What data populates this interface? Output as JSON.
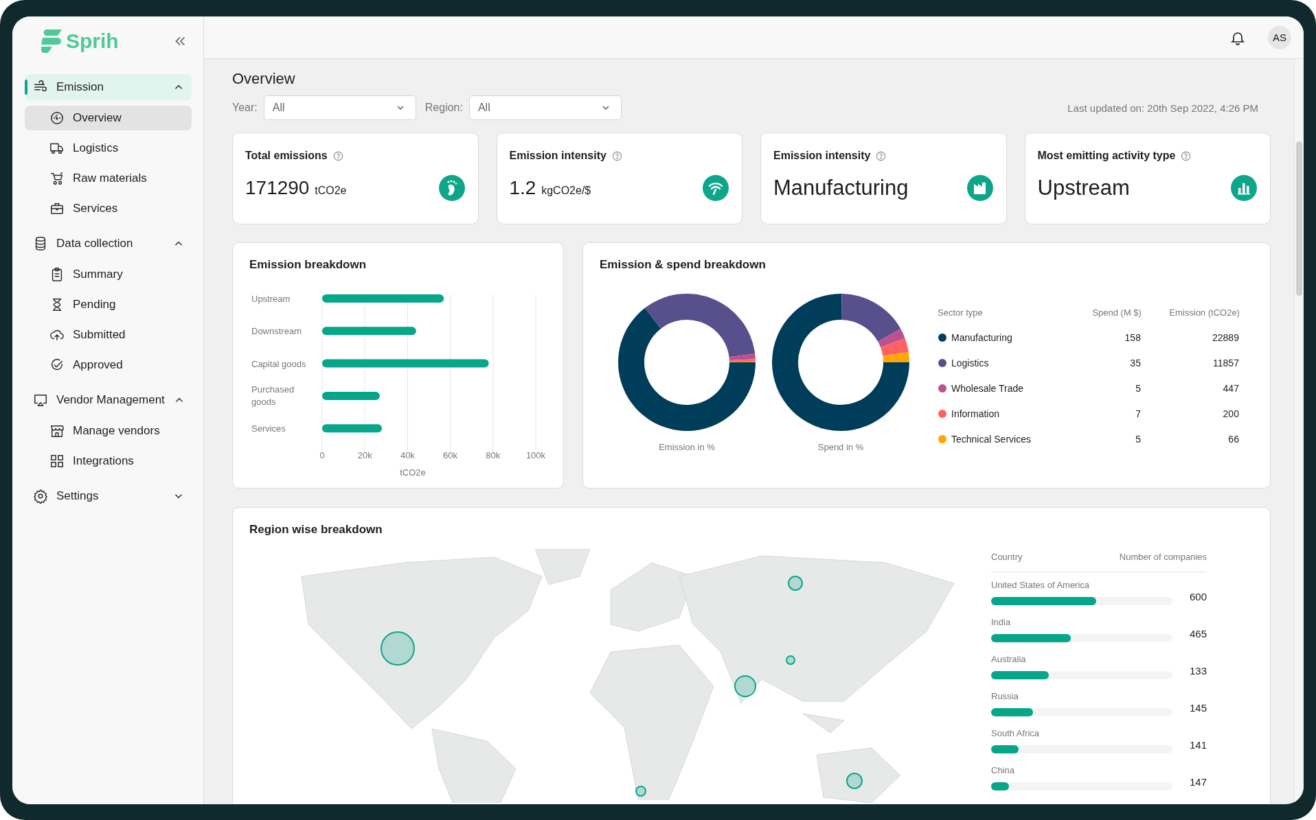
{
  "sidebar": {
    "brand": "Sprih",
    "groups": [
      {
        "label": "Emission",
        "expanded": true,
        "active": true,
        "items": [
          {
            "label": "Overview",
            "selected": true
          },
          {
            "label": "Logistics",
            "selected": false
          },
          {
            "label": "Raw materials",
            "selected": false
          },
          {
            "label": "Services",
            "selected": false
          }
        ]
      },
      {
        "label": "Data collection",
        "expanded": true,
        "active": false,
        "items": [
          {
            "label": "Summary",
            "selected": false
          },
          {
            "label": "Pending",
            "selected": false
          },
          {
            "label": "Submitted",
            "selected": false
          },
          {
            "label": "Approved",
            "selected": false
          }
        ]
      },
      {
        "label": "Vendor Management",
        "expanded": true,
        "active": false,
        "items": [
          {
            "label": "Manage vendors",
            "selected": false
          },
          {
            "label": "Integrations",
            "selected": false
          }
        ]
      },
      {
        "label": "Settings",
        "expanded": false,
        "active": false
      }
    ]
  },
  "header": {
    "avatar": "AS"
  },
  "page": {
    "title": "Overview",
    "filters": [
      {
        "label": "Year:",
        "value": "All"
      },
      {
        "label": "Region:",
        "value": "All"
      }
    ],
    "last_updated": "Last updated on: 20th Sep 2022, 4:26 PM"
  },
  "cards": [
    {
      "title": "Total emissions",
      "kind": "quantity",
      "value": "171290",
      "unit": "tCO2e"
    },
    {
      "title": "Emission intensity",
      "kind": "quantity",
      "value": "1.2",
      "unit": "kgCO2e/$"
    },
    {
      "title": "Emission intensity",
      "kind": "category",
      "value": "Manufacturing"
    },
    {
      "title": "Most emitting activity type",
      "kind": "category",
      "value": "Upstream"
    }
  ],
  "emission_breakdown": {
    "title": "Emission breakdown",
    "chart_data": {
      "type": "bar",
      "orientation": "horizontal",
      "categories": [
        "Upstream",
        "Downstream",
        "Capital goods",
        "Purchased goods",
        "Services"
      ],
      "values": [
        57000,
        44000,
        78000,
        27000,
        28000
      ],
      "grid": true,
      "xlabel": "tCO2e",
      "xlim": [
        0,
        100000
      ],
      "xticks": [
        {
          "value": 0,
          "label": "0"
        },
        {
          "value": 20000,
          "label": "20k"
        },
        {
          "value": 40000,
          "label": "40k"
        },
        {
          "value": 60000,
          "label": "60k"
        },
        {
          "value": 80000,
          "label": "80k"
        },
        {
          "value": 100000,
          "label": "100k"
        }
      ]
    }
  },
  "spend_breakdown": {
    "title": "Emission & spend breakdown",
    "charts": [
      {
        "chart_data": {
          "type": "donut",
          "title": "Emission in %",
          "values": [
            64.55,
            33.44,
            1.26,
            0.56,
            0.19
          ]
        }
      },
      {
        "chart_data": {
          "type": "donut",
          "title": "Spend in %",
          "values": [
            75.24,
            16.67,
            2.38,
            3.33,
            2.38
          ]
        }
      }
    ],
    "table": {
      "columns": [
        "Sector type",
        "Spend (M $)",
        "Emission (tCO2e)"
      ],
      "rows": [
        {
          "sector": "Manufacturing",
          "color": "#003d5b",
          "spend": "158",
          "emission": "22889"
        },
        {
          "sector": "Logistics",
          "color": "#58508d",
          "spend": "35",
          "emission": "11857"
        },
        {
          "sector": "Wholesale Trade",
          "color": "#bc5090",
          "spend": "5",
          "emission": "447"
        },
        {
          "sector": "Information",
          "color": "#ff6361",
          "spend": "7",
          "emission": "200"
        },
        {
          "sector": "Technical Services",
          "color": "#ffa600",
          "spend": "5",
          "emission": "66"
        }
      ]
    }
  },
  "region_breakdown": {
    "title": "Region wise breakdown",
    "table": {
      "columns": [
        "Country",
        "Number of companies"
      ],
      "rows": [
        {
          "country": "United States of America",
          "level": 0.58,
          "count": "600"
        },
        {
          "country": "India",
          "level": 0.44,
          "count": "465"
        },
        {
          "country": "Australia",
          "level": 0.32,
          "count": "133"
        },
        {
          "country": "Russia",
          "level": 0.23,
          "count": "145"
        },
        {
          "country": "South Africa",
          "level": 0.15,
          "count": "141"
        },
        {
          "country": "China",
          "level": 0.1,
          "count": "147"
        }
      ]
    }
  }
}
